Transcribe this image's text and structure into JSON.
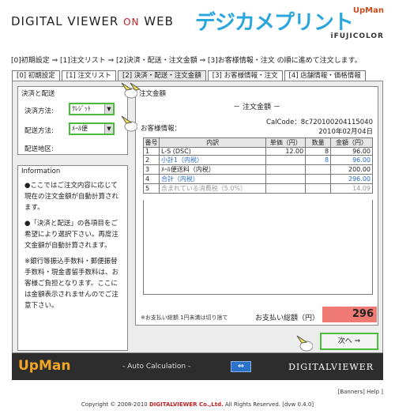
{
  "header": {
    "brand_left_a": "DIGITAL VIEWER",
    "brand_left_on": "ON",
    "brand_left_b": "WEB",
    "logo_main": "デジカメプリント",
    "logo_upman": "UpMan",
    "logo_sub": "iFUJICOLOR"
  },
  "steps_text": "[0]初期設定 ⇒ [1]注文リスト ⇒ [2]決済・配送・注文金額 ⇒ [3]お客様情報・注文  の順に進めて注文します。",
  "tabs": [
    {
      "label": "[0] 初期設定"
    },
    {
      "label": "[1] 注文リスト"
    },
    {
      "label": "[2] 決済・配送・注文金額"
    },
    {
      "label": "[3] お客様情報・注文"
    },
    {
      "label": "[4] 店舗情報・価格情報"
    }
  ],
  "settlement": {
    "title": "決済と配送",
    "payment_label": "決済方法:",
    "payment_value": "ｸﾚｼﾞｯﾄ",
    "delivery_label": "配送方法:",
    "delivery_value": "ﾒｰﾙ便",
    "area_label": "配送地区:"
  },
  "information": {
    "title": "Information",
    "p1": "●ここではご注文内容に応じて現在の注文金額が自動計算されます。",
    "p2": "●「決済と配送」の各項目をご希望により選択下さい。再度注文金額が自動計算されます。",
    "p3": "※銀行等振込手数料・郵便振替手数料・現金書留手数料は、お客様ご負担となります。ここには金額表示されませんのでご注意下さい。"
  },
  "order": {
    "panel_title": "注文金額",
    "heading": "－ 注文金額 －",
    "calcode": "CalCode：8c720100204115040",
    "date": "2010年02月04日",
    "customer_label": "お客様情報：",
    "columns": [
      "番号",
      "内訳",
      "単価（円）",
      "数量",
      "金額（円）"
    ],
    "rows": [
      {
        "no": "1",
        "desc": "L-S (DSC)",
        "price": "12.00",
        "qty": "8",
        "amount": "96.00",
        "style": ""
      },
      {
        "no": "2",
        "desc": "小計1（内税）",
        "price": "",
        "qty": "8",
        "amount": "96.00",
        "style": "blue"
      },
      {
        "no": "3",
        "desc": "ﾒｰﾙ便送料（内税）",
        "price": "",
        "qty": "",
        "amount": "200.00",
        "style": ""
      },
      {
        "no": "4",
        "desc": "合計（内税）",
        "price": "",
        "qty": "",
        "amount": "296.00",
        "style": "blue"
      },
      {
        "no": "5",
        "desc": "含まれている消費税（5.0%）",
        "price": "",
        "qty": "",
        "amount": "14.09",
        "style": "gray"
      }
    ],
    "note": "※お支払い総額 1円未満は切り捨て",
    "total_label": "お支払い総額（円）",
    "total_value": "296"
  },
  "next_button": "次へ ⇒",
  "footer": {
    "logo": "UpMan",
    "auto_calc": "- Auto Calculation -",
    "refresh_icon": "⇔",
    "brand": "DIGITALVIEWER"
  },
  "links": "[Banners] Help ]",
  "copyright_a": "Copyright © 2008-2010",
  "copyright_company": "DIGITALVIEWER Co.,Ltd.",
  "copyright_b": "All Rights Reserved. [dvw 0.4.0]"
}
